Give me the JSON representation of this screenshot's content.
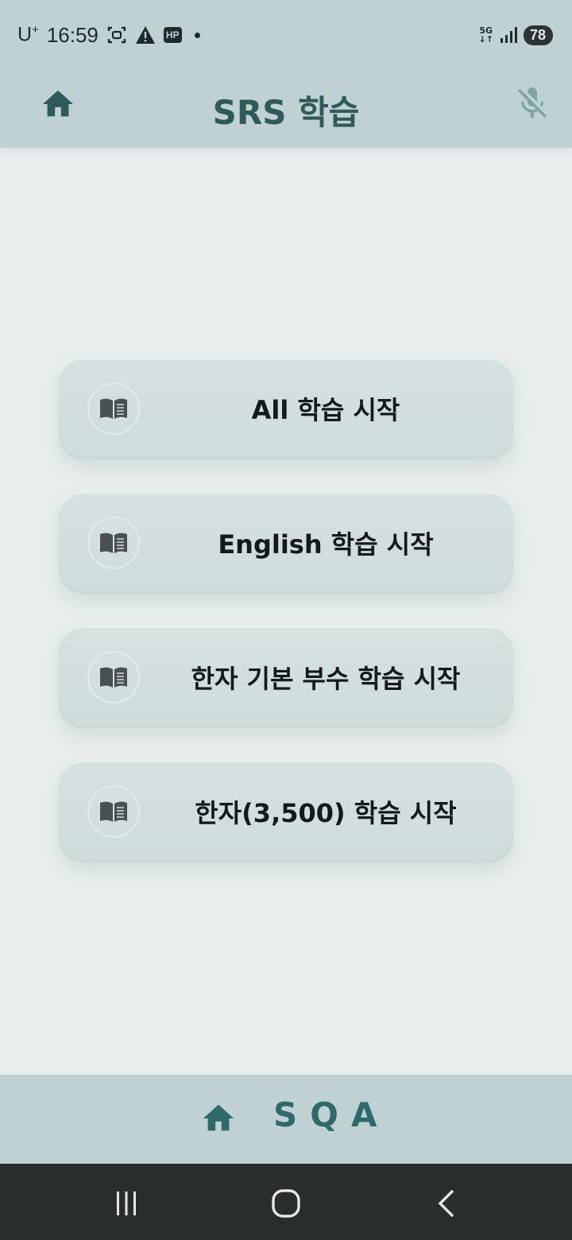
{
  "status_bar": {
    "carrier": "U",
    "carrier_sup": "+",
    "time": "16:59",
    "hp_badge": "HP",
    "network_top": "5G",
    "battery": "78"
  },
  "header": {
    "title": "SRS 학습"
  },
  "menu": {
    "items": [
      {
        "label": "All 학습 시작",
        "icon": "book-icon"
      },
      {
        "label": "English 학습 시작",
        "icon": "book-icon"
      },
      {
        "label": "한자 기본 부수 학습 시작",
        "icon": "book-icon"
      },
      {
        "label": "한자(3,500) 학습 시작",
        "icon": "book-icon"
      }
    ]
  },
  "bottom_bar": {
    "brand": "SQA"
  },
  "colors": {
    "header_bg": "#bfd1d3",
    "page_bg": "#e8eeee",
    "accent": "#2e5a5c",
    "button_bg": "#d3dfdf",
    "nav_bg": "#2a2d2e"
  }
}
